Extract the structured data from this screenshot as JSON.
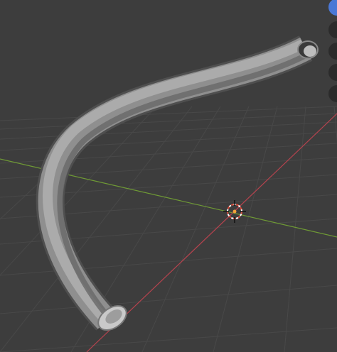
{
  "viewport": {
    "name": "3D Viewport",
    "background": "#3d3d3d",
    "grid_color": "#4a4a4a",
    "x_axis_color": "#b5434e",
    "y_axis_color": "#6f9a35",
    "origin_marker": "3d-cursor-icon",
    "object": {
      "type": "curved-tube",
      "color": "#a8a8a8"
    }
  },
  "navigation_gizmo": {
    "active_color": "#4a78d6",
    "inactive_color": "#2b2b2b",
    "icons": [
      "view-axis-icon",
      "zoom-icon",
      "pan-icon",
      "camera-icon",
      "perspective-icon"
    ]
  }
}
